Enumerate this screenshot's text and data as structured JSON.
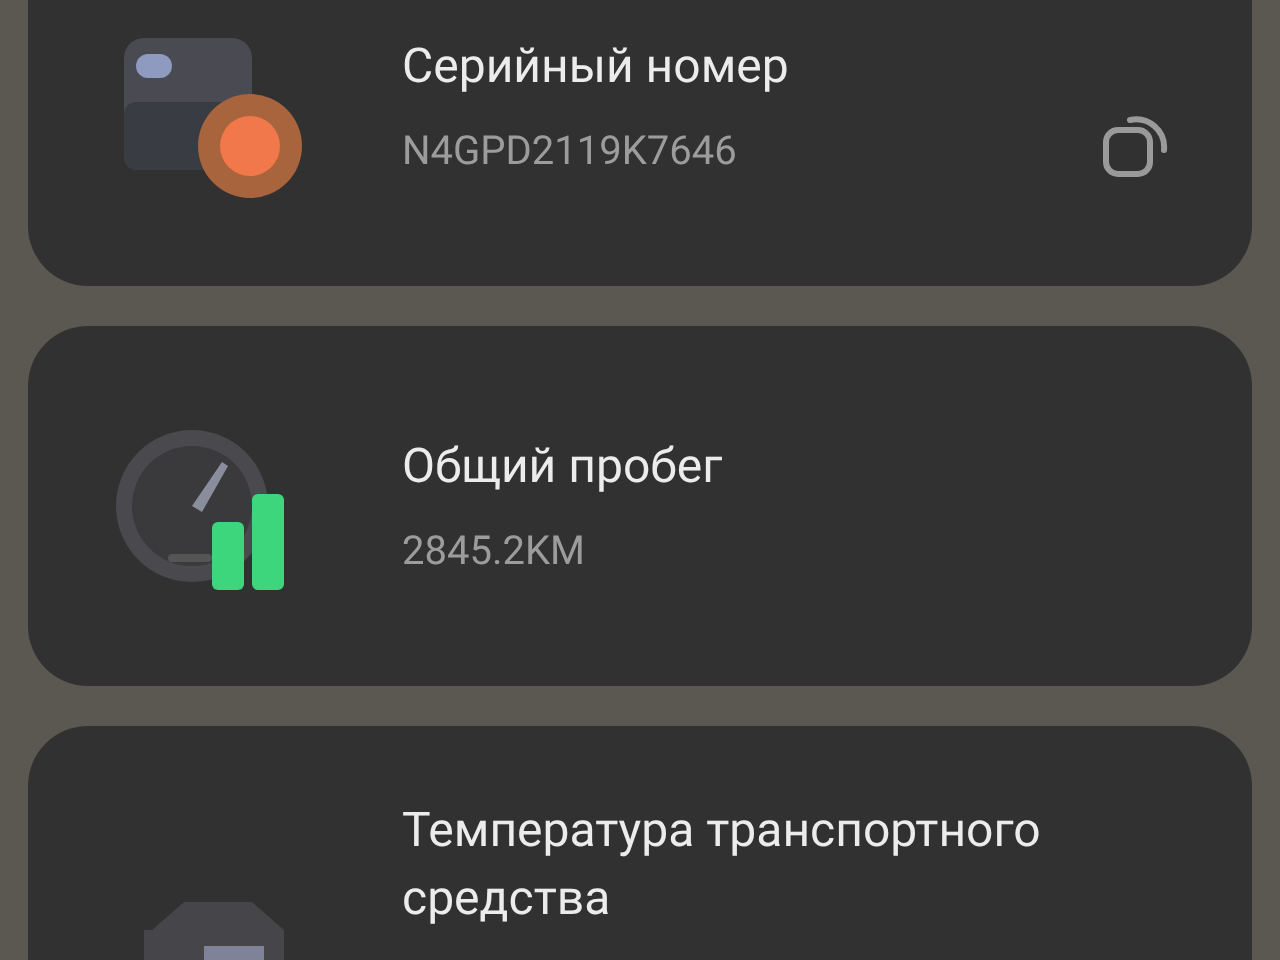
{
  "cards": [
    {
      "kind": "serial",
      "title": "Серийный номер",
      "value": "N4GPD2119K7646",
      "copyable": true
    },
    {
      "kind": "mileage",
      "title": "Общий пробег",
      "value": "2845.2KM",
      "copyable": false
    },
    {
      "kind": "temperature",
      "title": "Температура транспортного средства",
      "copyable": false
    }
  ]
}
